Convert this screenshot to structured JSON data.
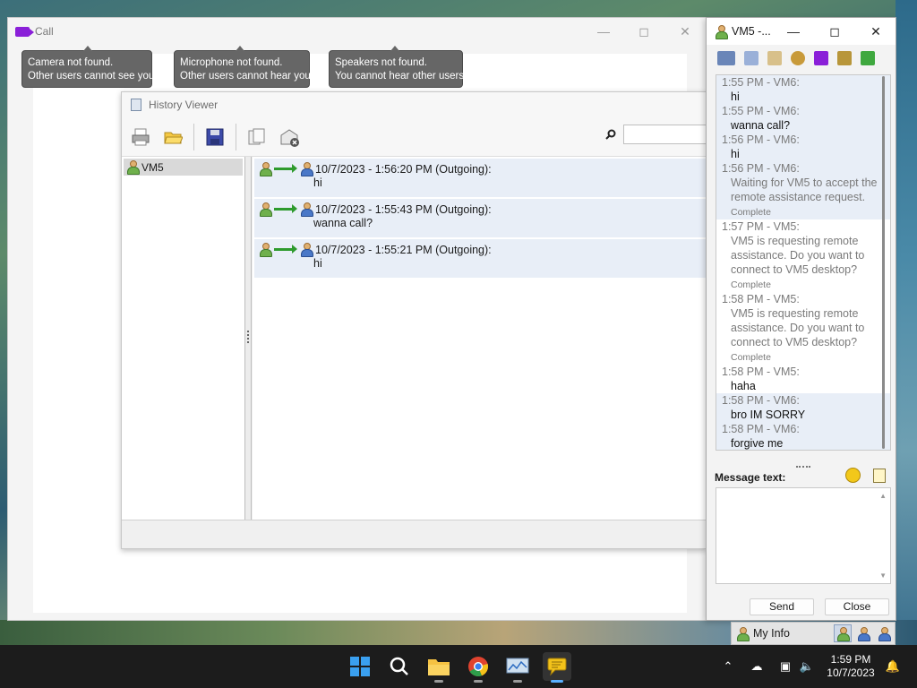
{
  "call_window": {
    "title": "Call",
    "tooltips": [
      {
        "line1": "Camera not found.",
        "line2": "Other users cannot see you."
      },
      {
        "line1": "Microphone not found.",
        "line2": "Other users cannot hear you."
      },
      {
        "line1": "Speakers not found.",
        "line2": "You cannot hear other users."
      }
    ]
  },
  "history_viewer": {
    "title": "History Viewer",
    "contacts": [
      "VM5"
    ],
    "messages": [
      {
        "header": "10/7/2023 - 1:56:20 PM (Outgoing):",
        "text": "hi"
      },
      {
        "header": "10/7/2023 - 1:55:43 PM (Outgoing):",
        "text": "wanna call?"
      },
      {
        "header": "10/7/2023 - 1:55:21 PM (Outgoing):",
        "text": "hi"
      }
    ]
  },
  "chat_window": {
    "title": "VM5 -...",
    "log": [
      {
        "head": "1:55 PM - VM6:",
        "text": "hi",
        "shade": true
      },
      {
        "head": "1:55 PM - VM6:",
        "text": "wanna call?",
        "shade": true
      },
      {
        "head": "1:56 PM - VM6:",
        "text": "hi",
        "shade": true
      },
      {
        "head": "1:56 PM - VM6:",
        "text": "Waiting for VM5 to accept the remote assistance request.",
        "note": "Complete",
        "gray": true,
        "shade": true
      },
      {
        "head": "1:57 PM - VM5:",
        "text": "VM5 is requesting remote assistance. Do you want to connect to VM5 desktop?",
        "note": "Complete",
        "gray": true,
        "shade": false
      },
      {
        "head": "1:58 PM - VM5:",
        "text": "VM5 is requesting remote assistance. Do you want to connect to VM5 desktop?",
        "note": "Complete",
        "gray": true,
        "shade": false
      },
      {
        "head": "1:58 PM - VM5:",
        "text": "haha",
        "shade": false
      },
      {
        "head": "1:58 PM - VM6:",
        "text": "bro IM SORRY",
        "shade": true
      },
      {
        "head": "1:58 PM - VM6:",
        "text": "forgive me",
        "shade": true
      }
    ],
    "message_label": "Message text:",
    "send_label": "Send",
    "close_label": "Close"
  },
  "tray_strip": {
    "my_info_label": "My Info"
  },
  "taskbar": {
    "time": "1:59 PM",
    "date": "10/7/2023"
  },
  "colors": {
    "accent": "#8a1fd8",
    "taskbar": "#1c1c1c",
    "message_bg": "#e8eef7"
  }
}
